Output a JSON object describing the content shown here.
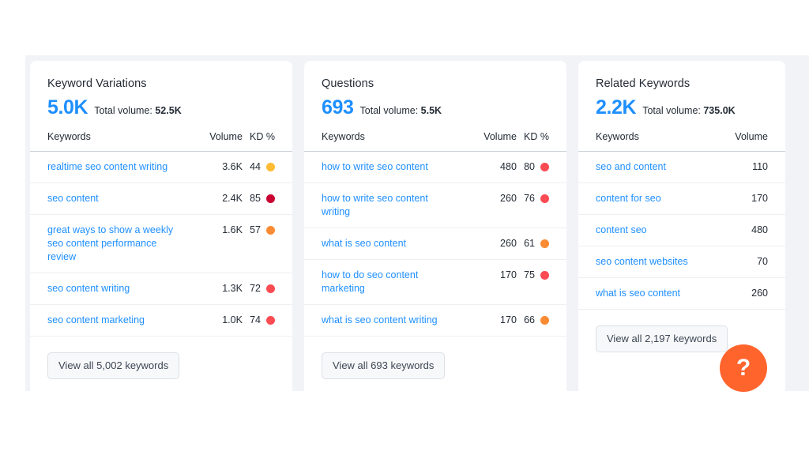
{
  "theme": {
    "page_background": "#ffffff",
    "band_background": "#f1f3f7",
    "card_background": "#ffffff",
    "link_blue": "#1e8fff",
    "text_dark": "#232b35",
    "fab_orange": "#ff642d"
  },
  "cards": [
    {
      "title": "Keyword Variations",
      "count": "5.0K",
      "volume_label": "Total volume:",
      "volume_value": "52.5K",
      "columns": [
        "Keywords",
        "Volume",
        "KD %"
      ],
      "has_kd": true,
      "rows": [
        {
          "keyword": "realtime seo content writing",
          "volume": "3.6K",
          "kd": "44",
          "kd_color": "#ffbb33"
        },
        {
          "keyword": "seo content",
          "volume": "2.4K",
          "kd": "85",
          "kd_color": "#c90031"
        },
        {
          "keyword": "great ways to show a weekly seo content performance review",
          "volume": "1.6K",
          "kd": "57",
          "kd_color": "#fb8b33"
        },
        {
          "keyword": "seo content writing",
          "volume": "1.3K",
          "kd": "72",
          "kd_color": "#fb4b52"
        },
        {
          "keyword": "seo content marketing",
          "volume": "1.0K",
          "kd": "74",
          "kd_color": "#fb4b52"
        }
      ],
      "view_all_label": "View all 5,002 keywords"
    },
    {
      "title": "Questions",
      "count": "693",
      "volume_label": "Total volume:",
      "volume_value": "5.5K",
      "columns": [
        "Keywords",
        "Volume",
        "KD %"
      ],
      "has_kd": true,
      "rows": [
        {
          "keyword": "how to write seo content",
          "volume": "480",
          "kd": "80",
          "kd_color": "#fb4b52"
        },
        {
          "keyword": "how to write seo content writing",
          "volume": "260",
          "kd": "76",
          "kd_color": "#fb4b52"
        },
        {
          "keyword": "what is seo content",
          "volume": "260",
          "kd": "61",
          "kd_color": "#fb8b33"
        },
        {
          "keyword": "how to do seo content marketing",
          "volume": "170",
          "kd": "75",
          "kd_color": "#fb4b52"
        },
        {
          "keyword": "what is seo content writing",
          "volume": "170",
          "kd": "66",
          "kd_color": "#fb8b33"
        }
      ],
      "view_all_label": "View all 693 keywords"
    },
    {
      "title": "Related Keywords",
      "count": "2.2K",
      "volume_label": "Total volume:",
      "volume_value": "735.0K",
      "columns": [
        "Keywords",
        "Volume"
      ],
      "has_kd": false,
      "rows": [
        {
          "keyword": "seo and content",
          "volume": "110"
        },
        {
          "keyword": "content for seo",
          "volume": "170"
        },
        {
          "keyword": "content seo",
          "volume": "480"
        },
        {
          "keyword": "seo content websites",
          "volume": "70"
        },
        {
          "keyword": "what is seo content",
          "volume": "260"
        }
      ],
      "view_all_label": "View all 2,197 keywords"
    }
  ],
  "help_button": {
    "glyph": "?",
    "name": "help-fab"
  }
}
